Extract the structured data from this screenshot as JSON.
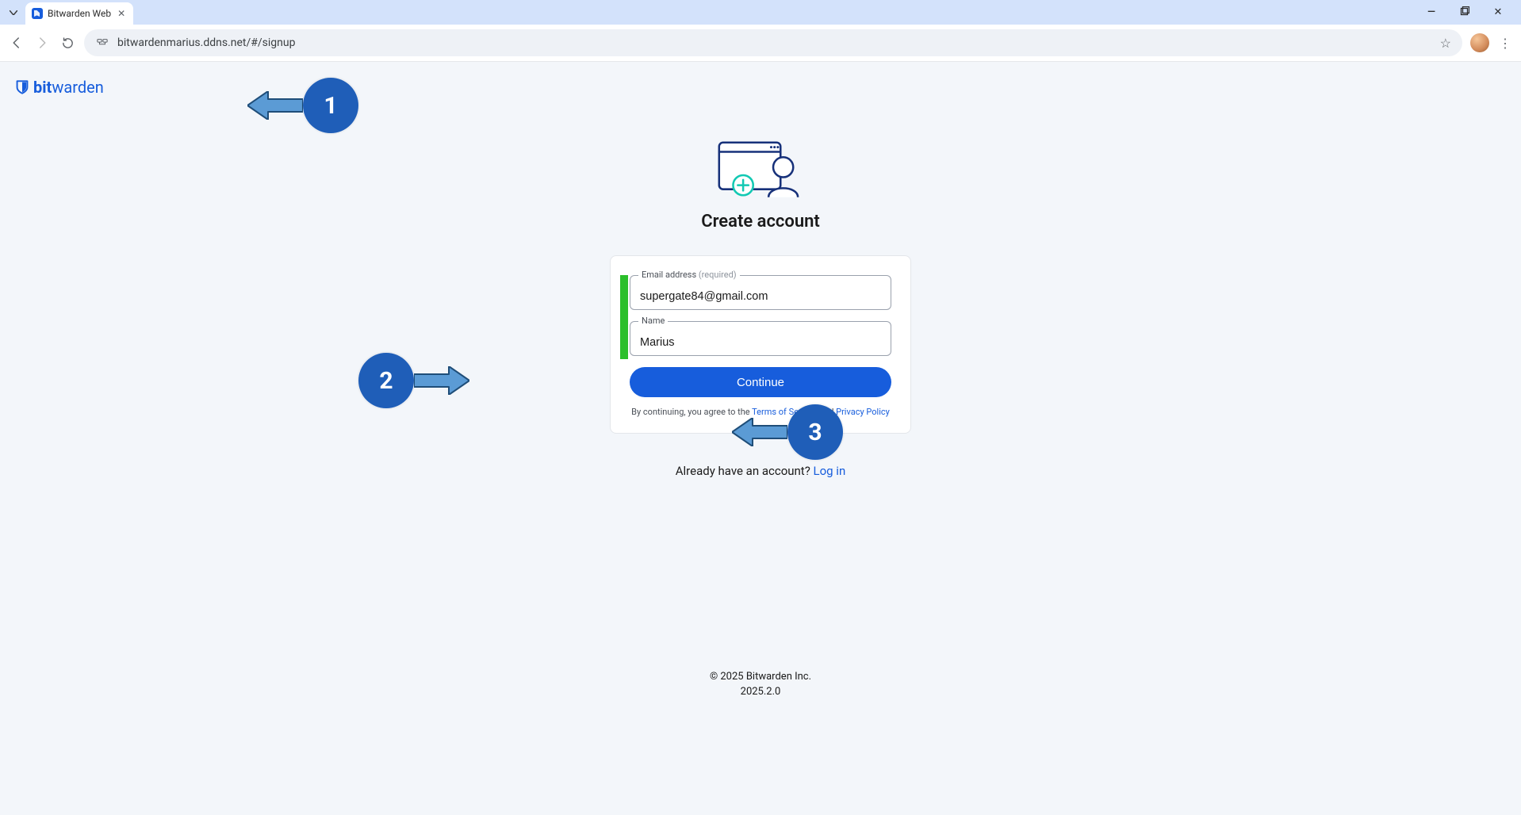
{
  "browser": {
    "tab_title": "Bitwarden Web",
    "url": "bitwardenmarius.ddns.net/#/signup"
  },
  "brand": {
    "name_bold": "bit",
    "name_rest": "warden"
  },
  "page_title": "Create account",
  "form": {
    "email_label": "Email address",
    "email_required": "(required)",
    "email_value": "supergate84@gmail.com",
    "name_label": "Name",
    "name_value": "Marius",
    "continue_label": "Continue"
  },
  "legal": {
    "prefix": "By continuing, you agree to the ",
    "tos": "Terms of Service",
    "and": " and ",
    "privacy": "Privacy Policy"
  },
  "already": {
    "text": "Already have an account? ",
    "login": "Log in"
  },
  "footer": {
    "copyright": "© 2025 Bitwarden Inc.",
    "version": "2025.2.0"
  },
  "annotations": {
    "n1": "1",
    "n2": "2",
    "n3": "3"
  }
}
